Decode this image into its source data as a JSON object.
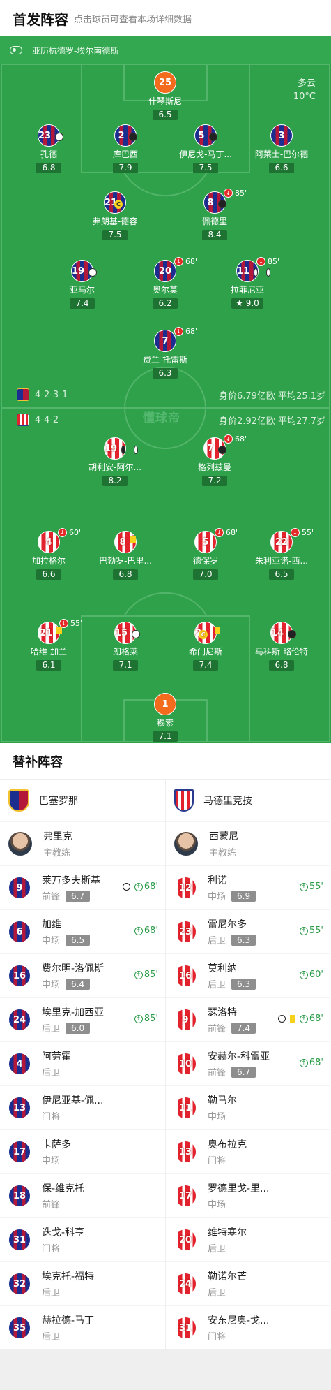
{
  "header": {
    "title": "首发阵容",
    "hint": "点击球员可查看本场详细数据"
  },
  "venue": "亚历杭德罗-埃尔南德斯",
  "weather": {
    "condition": "多云",
    "temp": "10°C"
  },
  "home": {
    "formation": "4-2-3-1",
    "value": "身价6.79亿欧",
    "age": "平均25.1岁"
  },
  "away": {
    "formation": "4-4-2",
    "value": "身价2.92亿欧",
    "age": "平均27.7岁"
  },
  "watermark": "懂球帝",
  "home_players": [
    {
      "num": "25",
      "name": "什琴斯尼",
      "rating": "6.5"
    },
    {
      "num": "23",
      "name": "孔德",
      "rating": "6.8"
    },
    {
      "num": "2",
      "name": "库巴西",
      "rating": "7.9"
    },
    {
      "num": "5",
      "name": "伊尼戈-马丁...",
      "rating": "7.5"
    },
    {
      "num": "3",
      "name": "阿莱士-巴尔德",
      "rating": "6.6"
    },
    {
      "num": "21",
      "name": "弗朗基-德容",
      "rating": "7.5"
    },
    {
      "num": "8",
      "name": "佩德里",
      "rating": "8.4",
      "sub": "85'"
    },
    {
      "num": "19",
      "name": "亚马尔",
      "rating": "7.4"
    },
    {
      "num": "20",
      "name": "奥尔莫",
      "rating": "6.2",
      "sub": "68'"
    },
    {
      "num": "11",
      "name": "拉菲尼亚",
      "rating": "9.0",
      "sub": "85'"
    },
    {
      "num": "7",
      "name": "费兰-托雷斯",
      "rating": "6.3",
      "sub": "68'"
    }
  ],
  "away_players": [
    {
      "num": "19",
      "name": "胡利安-阿尔...",
      "rating": "8.2"
    },
    {
      "num": "7",
      "name": "格列兹曼",
      "rating": "7.2",
      "sub": "68'"
    },
    {
      "num": "4",
      "name": "加拉格尔",
      "rating": "6.6",
      "sub": "60'"
    },
    {
      "num": "8",
      "name": "巴勃罗-巴里...",
      "rating": "6.8"
    },
    {
      "num": "5",
      "name": "德保罗",
      "rating": "7.0",
      "sub": "68'"
    },
    {
      "num": "22",
      "name": "朱利亚诺-西...",
      "rating": "6.5",
      "sub": "55'"
    },
    {
      "num": "21",
      "name": "哈维-加兰",
      "rating": "6.1",
      "sub": "55'"
    },
    {
      "num": "15",
      "name": "朗格莱",
      "rating": "7.1"
    },
    {
      "num": "2",
      "name": "希门尼斯",
      "rating": "7.4"
    },
    {
      "num": "14",
      "name": "马科斯-略伦特",
      "rating": "6.8"
    },
    {
      "num": "1",
      "name": "穆索",
      "rating": "7.1"
    }
  ],
  "subs": {
    "title": "替补阵容",
    "home": {
      "team": "巴塞罗那",
      "coach": {
        "name": "弗里克",
        "role": "主教练"
      },
      "players": [
        {
          "num": "9",
          "name": "莱万多夫斯基",
          "pos": "前锋",
          "rating": "6.7",
          "in": "68'"
        },
        {
          "num": "6",
          "name": "加维",
          "pos": "中场",
          "rating": "6.5",
          "in": "68'"
        },
        {
          "num": "16",
          "name": "费尔明-洛佩斯",
          "pos": "中场",
          "rating": "6.4",
          "in": "85'"
        },
        {
          "num": "24",
          "name": "埃里克-加西亚",
          "pos": "后卫",
          "rating": "6.0",
          "in": "85'"
        },
        {
          "num": "4",
          "name": "阿劳霍",
          "pos": "后卫"
        },
        {
          "num": "13",
          "name": "伊尼亚基-佩...",
          "pos": "门将"
        },
        {
          "num": "17",
          "name": "卡萨多",
          "pos": "中场"
        },
        {
          "num": "18",
          "name": "保-维克托",
          "pos": "前锋"
        },
        {
          "num": "31",
          "name": "迭戈-科亨",
          "pos": "门将"
        },
        {
          "num": "32",
          "name": "埃克托-福特",
          "pos": "后卫"
        },
        {
          "num": "35",
          "name": "赫拉德-马丁",
          "pos": "后卫"
        }
      ]
    },
    "away": {
      "team": "马德里竞技",
      "coach": {
        "name": "西蒙尼",
        "role": "主教练"
      },
      "players": [
        {
          "num": "12",
          "name": "利诺",
          "pos": "中场",
          "rating": "6.9",
          "in": "55'"
        },
        {
          "num": "23",
          "name": "雷尼尔多",
          "pos": "后卫",
          "rating": "6.3",
          "in": "55'"
        },
        {
          "num": "16",
          "name": "莫利纳",
          "pos": "后卫",
          "rating": "6.3",
          "in": "60'"
        },
        {
          "num": "9",
          "name": "瑟洛特",
          "pos": "前锋",
          "rating": "7.4",
          "in": "68'"
        },
        {
          "num": "10",
          "name": "安赫尔-科雷亚",
          "pos": "前锋",
          "rating": "6.7",
          "in": "68'"
        },
        {
          "num": "11",
          "name": "勒马尔",
          "pos": "中场"
        },
        {
          "num": "13",
          "name": "奥布拉克",
          "pos": "门将"
        },
        {
          "num": "17",
          "name": "罗德里戈-里...",
          "pos": "中场"
        },
        {
          "num": "20",
          "name": "维特塞尔",
          "pos": "后卫"
        },
        {
          "num": "24",
          "name": "勒诺尔芒",
          "pos": "后卫"
        },
        {
          "num": "31",
          "name": "安东尼奥-戈...",
          "pos": "门将"
        }
      ]
    }
  }
}
